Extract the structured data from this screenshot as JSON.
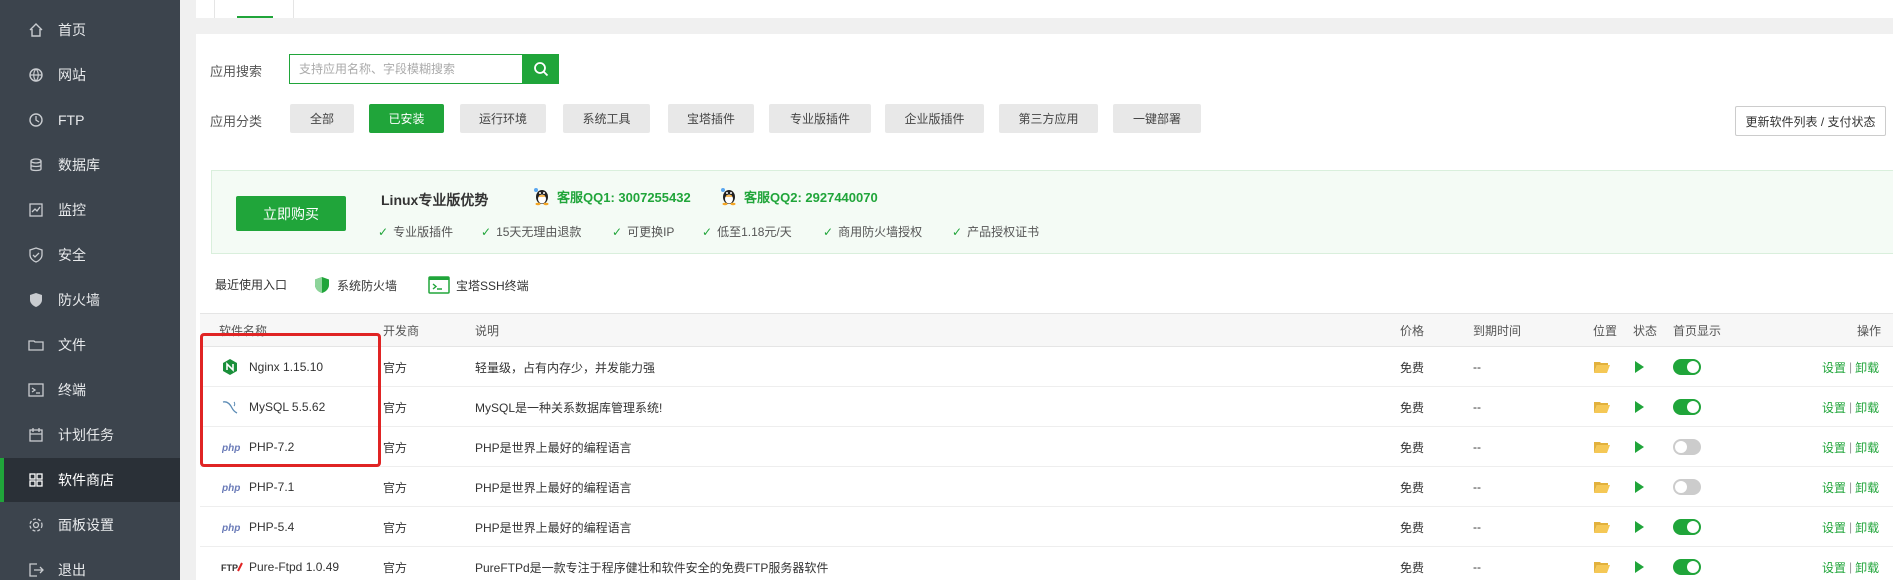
{
  "sidebar": {
    "items": [
      {
        "label": "首页",
        "icon": "home-icon"
      },
      {
        "label": "网站",
        "icon": "globe-icon"
      },
      {
        "label": "FTP",
        "icon": "ftp-icon"
      },
      {
        "label": "数据库",
        "icon": "database-icon"
      },
      {
        "label": "监控",
        "icon": "monitor-icon"
      },
      {
        "label": "安全",
        "icon": "shield-icon"
      },
      {
        "label": "防火墙",
        "icon": "firewall-icon"
      },
      {
        "label": "文件",
        "icon": "folder-icon"
      },
      {
        "label": "终端",
        "icon": "terminal-icon"
      },
      {
        "label": "计划任务",
        "icon": "calendar-icon"
      },
      {
        "label": "软件商店",
        "icon": "grid-icon",
        "active": true
      },
      {
        "label": "面板设置",
        "icon": "gear-icon"
      },
      {
        "label": "退出",
        "icon": "logout-icon"
      }
    ]
  },
  "search": {
    "label": "应用搜索",
    "placeholder": "支持应用名称、字段模糊搜索"
  },
  "categories": {
    "label": "应用分类",
    "items": [
      "全部",
      "已安装",
      "运行环境",
      "系统工具",
      "宝塔插件",
      "专业版插件",
      "企业版插件",
      "第三方应用",
      "一键部署"
    ],
    "active": "已安装"
  },
  "update_button": "更新软件列表 / 支付状态",
  "promo": {
    "buy_button": "立即购买",
    "title": "Linux专业版优势",
    "qq1": "客服QQ1: 3007255432",
    "qq2": "客服QQ2: 2927440070",
    "features": [
      "专业版插件",
      "15天无理由退款",
      "可更换IP",
      "低至1.18元/天",
      "商用防火墙授权",
      "产品授权证书"
    ]
  },
  "recent": {
    "label": "最近使用入口",
    "items": [
      "系统防火墙",
      "宝塔SSH终端"
    ]
  },
  "table": {
    "headers": {
      "name": "软件名称",
      "developer": "开发商",
      "description": "说明",
      "price": "价格",
      "expire": "到期时间",
      "location": "位置",
      "status": "状态",
      "homepage": "首页显示",
      "actions": "操作"
    },
    "rows": [
      {
        "name": "Nginx 1.15.10",
        "icon": "nginx-icon",
        "developer": "官方",
        "description": "轻量级，占有内存少，并发能力强",
        "price": "免费",
        "expire": "--",
        "homepage_on": true,
        "settings": "设置",
        "uninstall": "卸载"
      },
      {
        "name": "MySQL 5.5.62",
        "icon": "mysql-icon",
        "developer": "官方",
        "description": "MySQL是一种关系数据库管理系统!",
        "price": "免费",
        "expire": "--",
        "homepage_on": true,
        "settings": "设置",
        "uninstall": "卸载"
      },
      {
        "name": "PHP-7.2",
        "icon": "php-icon",
        "developer": "官方",
        "description": "PHP是世界上最好的编程语言",
        "price": "免费",
        "expire": "--",
        "homepage_on": false,
        "settings": "设置",
        "uninstall": "卸载"
      },
      {
        "name": "PHP-7.1",
        "icon": "php-icon",
        "developer": "官方",
        "description": "PHP是世界上最好的编程语言",
        "price": "免费",
        "expire": "--",
        "homepage_on": false,
        "settings": "设置",
        "uninstall": "卸载"
      },
      {
        "name": "PHP-5.4",
        "icon": "php-icon",
        "developer": "官方",
        "description": "PHP是世界上最好的编程语言",
        "price": "免费",
        "expire": "--",
        "homepage_on": true,
        "settings": "设置",
        "uninstall": "卸载"
      },
      {
        "name": "Pure-Ftpd 1.0.49",
        "icon": "ftp-logo-icon",
        "developer": "官方",
        "description": "PureFTPd是一款专注于程序健壮和软件安全的免费FTP服务器软件",
        "price": "免费",
        "expire": "--",
        "homepage_on": true,
        "settings": "设置",
        "uninstall": "卸载"
      }
    ]
  },
  "colors": {
    "accent": "#20a53a",
    "sidebar_bg": "#3c444d",
    "highlight": "#e02424"
  }
}
